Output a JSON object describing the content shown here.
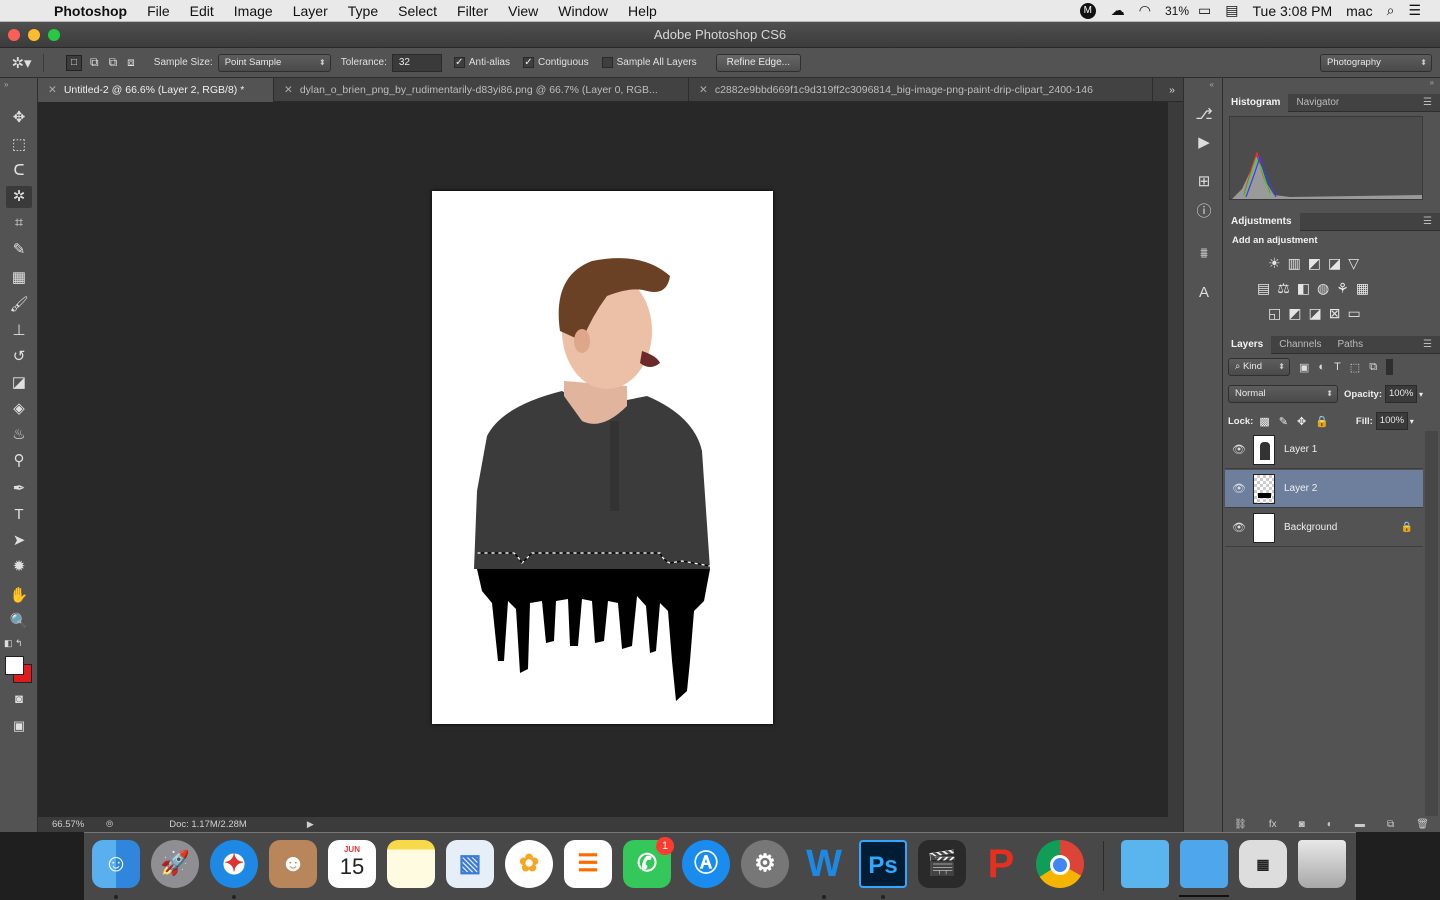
{
  "menubar": {
    "app_name": "Photoshop",
    "items": [
      "File",
      "Edit",
      "Image",
      "Layer",
      "Type",
      "Select",
      "Filter",
      "View",
      "Window",
      "Help"
    ],
    "battery": "31%",
    "clock": "Tue 3:08 PM",
    "user": "mac"
  },
  "window": {
    "title": "Adobe Photoshop CS6"
  },
  "options": {
    "sample_size_label": "Sample Size:",
    "sample_size_value": "Point Sample",
    "tolerance_label": "Tolerance:",
    "tolerance_value": "32",
    "antialias_label": "Anti-alias",
    "contiguous_label": "Contiguous",
    "sample_all_label": "Sample All Layers",
    "refine_edge_label": "Refine Edge...",
    "workspace": "Photography"
  },
  "tabs": [
    {
      "label": "Untitled-2 @ 66.6% (Layer 2, RGB/8) *"
    },
    {
      "label": "dylan_o_brien_png_by_rudimentarily-d83yi86.png @ 66.7% (Layer 0, RGB..."
    },
    {
      "label": "c2882e9bbd669f1c9d319ff2c3096814_big-image-png-paint-drip-clipart_2400-146"
    }
  ],
  "status": {
    "zoom": "66.57%",
    "doc": "Doc: 1.17M/2.28M"
  },
  "histogram_panel": {
    "tab1": "Histogram",
    "tab2": "Navigator"
  },
  "adjustments_panel": {
    "tab": "Adjustments",
    "subtitle": "Add an adjustment"
  },
  "layers_panel": {
    "tabs": [
      "Layers",
      "Channels",
      "Paths"
    ],
    "filter": "Kind",
    "blend_mode": "Normal",
    "opacity_label": "Opacity:",
    "opacity_value": "100%",
    "lock_label": "Lock:",
    "fill_label": "Fill:",
    "fill_value": "100%",
    "layers": [
      {
        "name": "Layer 1"
      },
      {
        "name": "Layer 2"
      },
      {
        "name": "Background"
      }
    ]
  },
  "dock": {
    "calendar_month": "JUN",
    "calendar_day": "15",
    "facetime_badge": "1",
    "ps_label": "Ps"
  },
  "colors": {
    "accent_selected_layer": "#6e7f9e",
    "ui_panel": "#535353",
    "foreground": "#ffffff",
    "background_swatch": "#e11b1b"
  }
}
